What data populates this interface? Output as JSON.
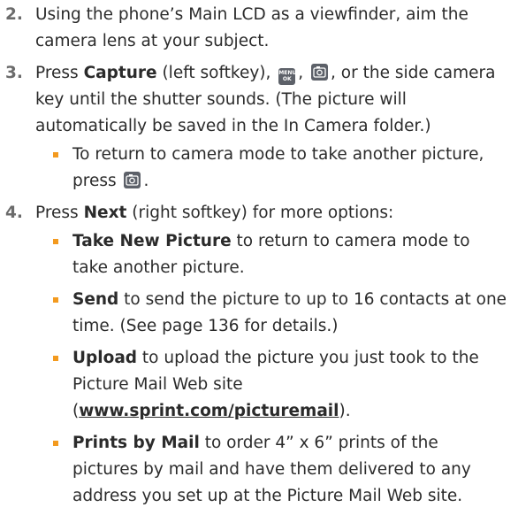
{
  "steps": [
    {
      "number": "2.",
      "text": "Using the phone’s Main LCD as a viewfinder, aim the camera lens at your subject."
    },
    {
      "number": "3.",
      "bold": "Capture",
      "text_a": " (left softkey), ",
      "sep1": ", ",
      "text_b": ", or the side camera key until the shutter sounds. (The picture will automatically be saved in the In Camera folder.)",
      "bullets": [
        {
          "text": "To return to camera mode to take another picture, press ",
          "end": "."
        }
      ]
    },
    {
      "number": "4.",
      "text_pre": "Press ",
      "bold": "Next",
      "text": " (right softkey) for more options:",
      "bullets": [
        {
          "bold": "Take New Picture",
          "text": " to return to camera mode to take another picture."
        },
        {
          "bold": "Send",
          "text": " to send the picture to up to 16 contacts at one time. (See page 136 for details.)"
        },
        {
          "bold": "Upload",
          "text": " to upload the picture you just took to the Picture Mail Web site (",
          "link": "www.sprint.com/picturemail",
          "end": ")."
        },
        {
          "bold": "Prints by Mail",
          "text": "  to order 4” x 6” prints of the pictures by mail and have them delivered to any address you set up at the Picture Mail Web site."
        }
      ]
    }
  ],
  "icons": {
    "menu_ok_top": "MENU",
    "menu_ok_bottom": "OK",
    "key_color": "#5d6169",
    "bullet_color": "#f39a1f"
  }
}
